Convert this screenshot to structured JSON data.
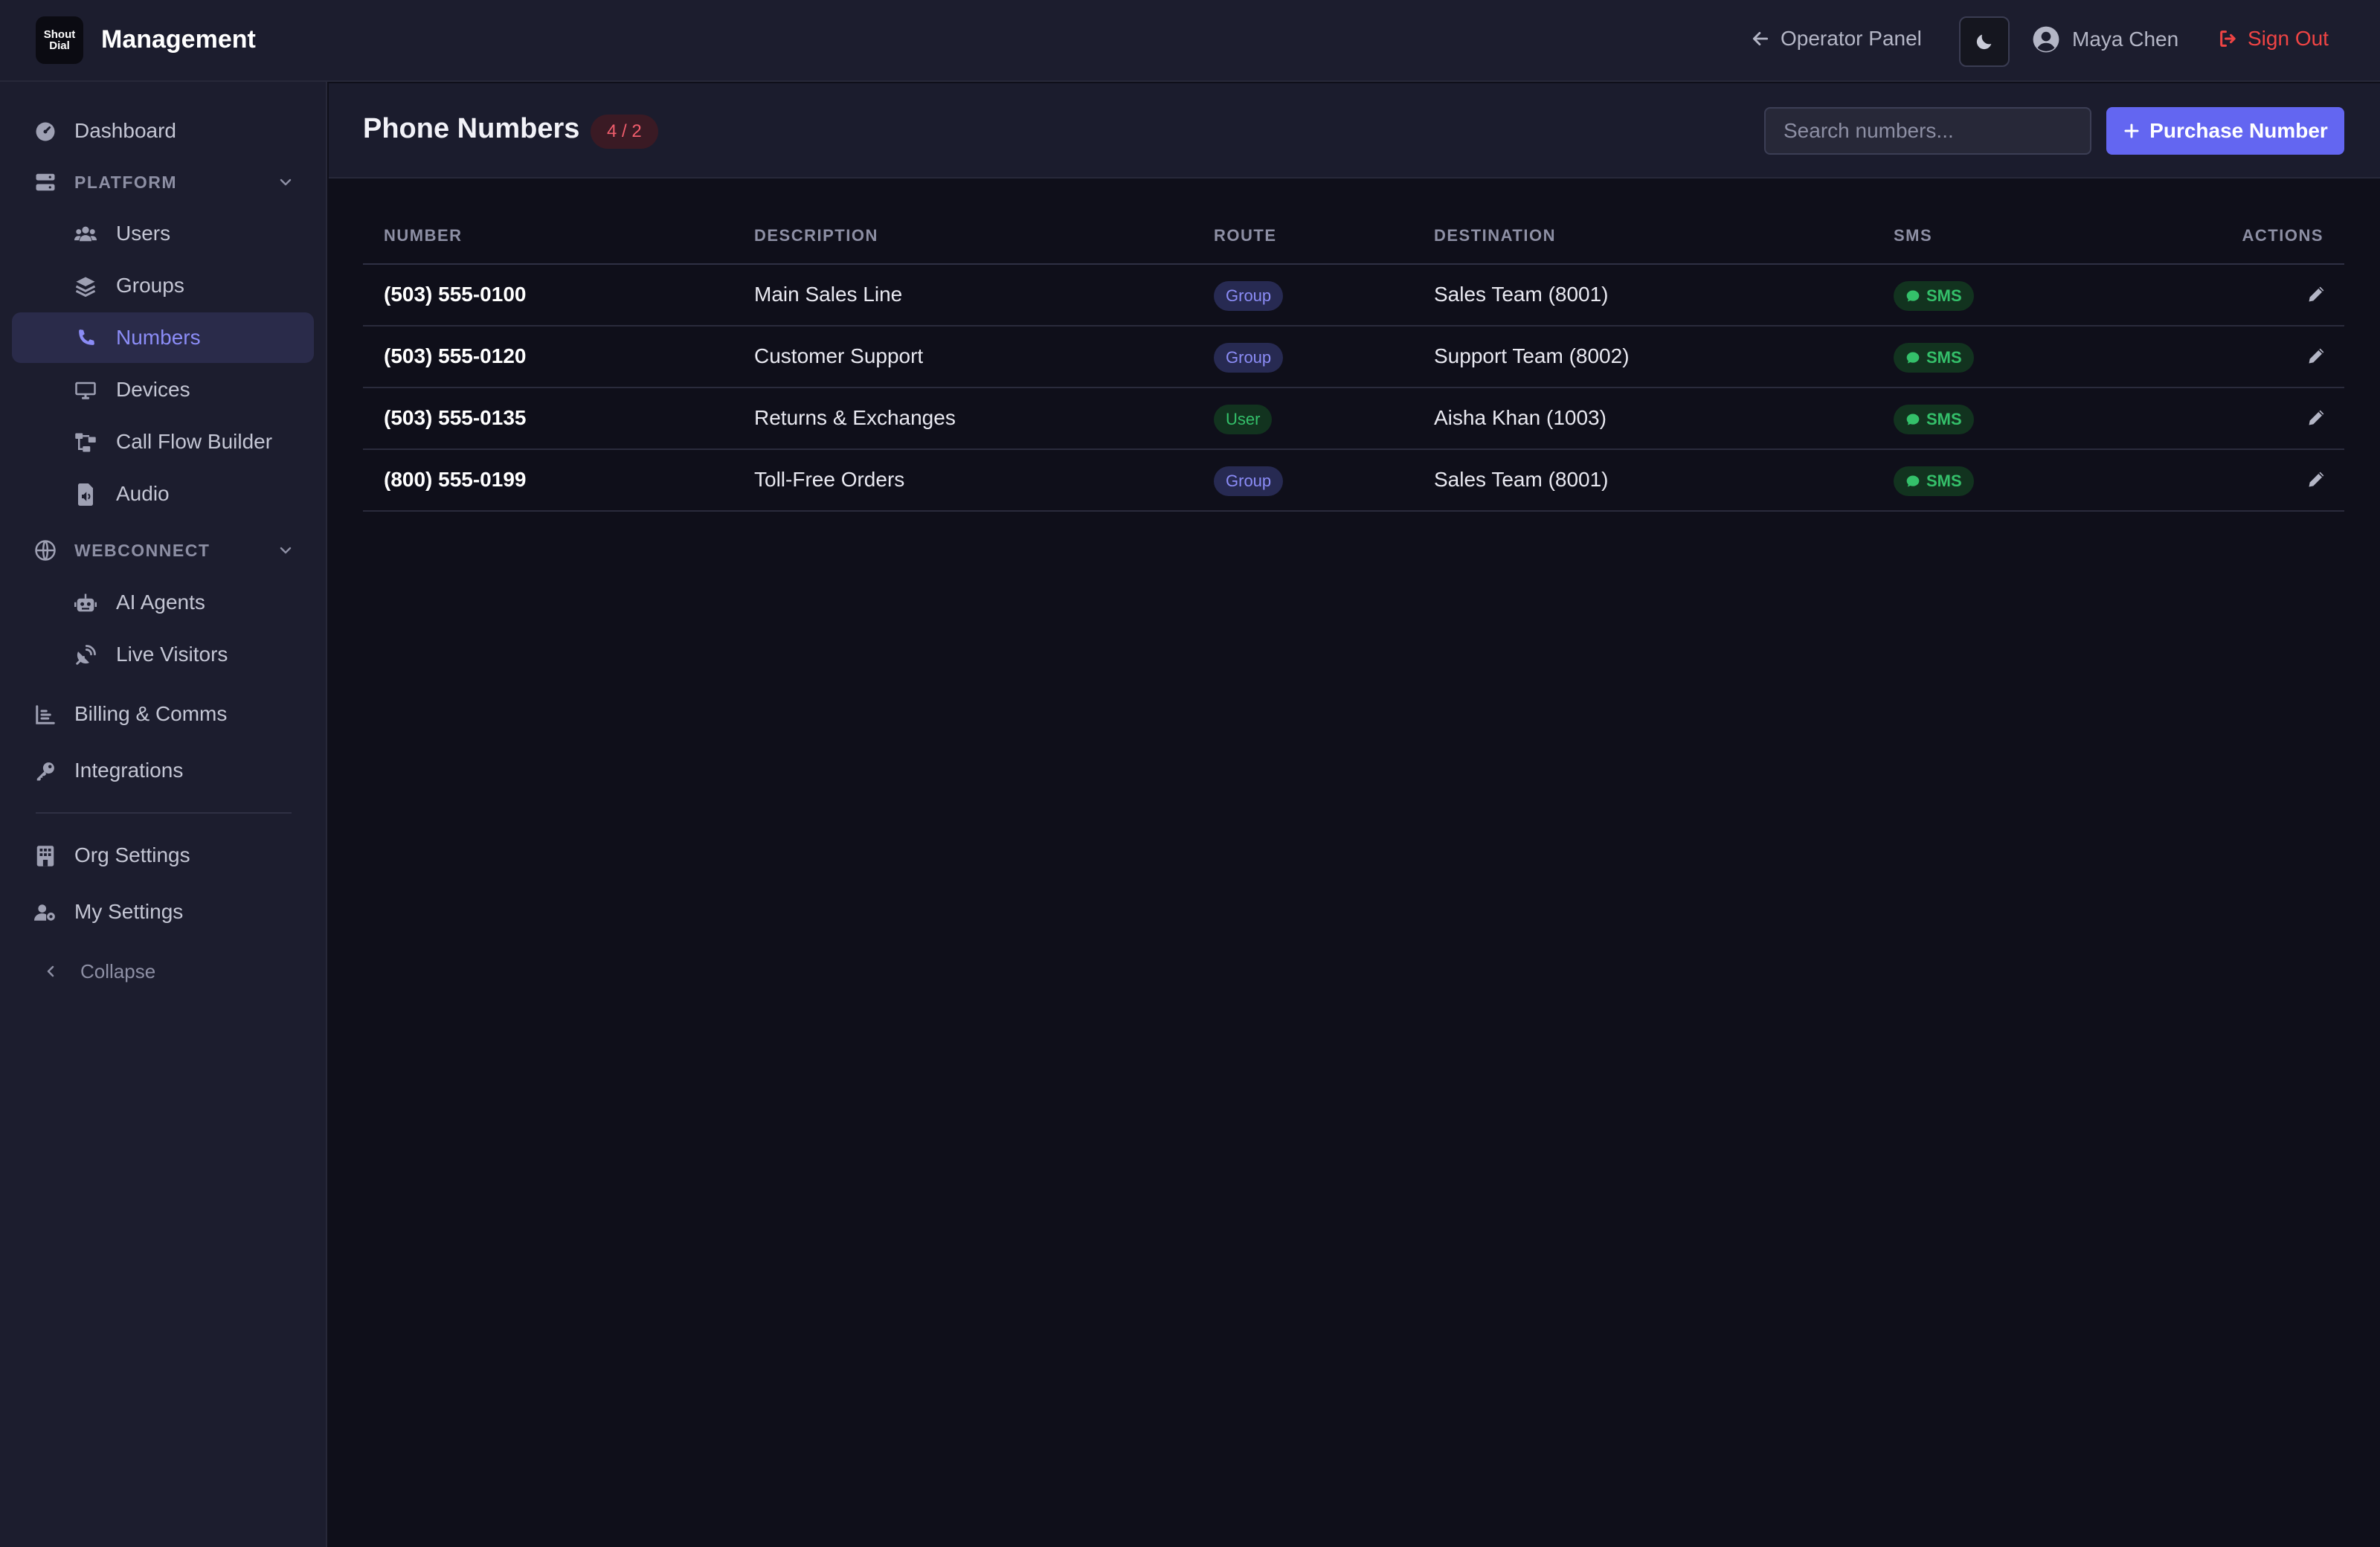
{
  "app": {
    "logo_line1": "Shout",
    "logo_line2": "Dial",
    "title": "Management"
  },
  "topbar": {
    "operator_panel": "Operator Panel",
    "user_name": "Maya Chen",
    "sign_out": "Sign Out",
    "theme_icon": "moon-icon"
  },
  "sidebar": {
    "dashboard": "Dashboard",
    "platform": "PLATFORM",
    "platform_items": [
      "Users",
      "Groups",
      "Numbers",
      "Devices",
      "Call Flow Builder",
      "Audio"
    ],
    "webconnect": "WEBCONNECT",
    "webconnect_items": [
      "AI Agents",
      "Live Visitors"
    ],
    "billing": "Billing & Comms",
    "integrations": "Integrations",
    "org_settings": "Org Settings",
    "my_settings": "My Settings",
    "collapse": "Collapse",
    "active_item": "Numbers"
  },
  "page": {
    "title": "Phone Numbers",
    "count_badge": "4 / 2",
    "search_placeholder": "Search numbers...",
    "purchase_label": "Purchase Number"
  },
  "table": {
    "headers": {
      "number": "NUMBER",
      "description": "DESCRIPTION",
      "route": "ROUTE",
      "destination": "DESTINATION",
      "sms": "SMS",
      "actions": "ACTIONS"
    },
    "rows": [
      {
        "number": "(503) 555-0100",
        "description": "Main Sales Line",
        "route": "Group",
        "destination": "Sales Team (8001)",
        "sms": "SMS"
      },
      {
        "number": "(503) 555-0120",
        "description": "Customer Support",
        "route": "Group",
        "destination": "Support Team (8002)",
        "sms": "SMS"
      },
      {
        "number": "(503) 555-0135",
        "description": "Returns & Exchanges",
        "route": "User",
        "destination": "Aisha Khan (1003)",
        "sms": "SMS"
      },
      {
        "number": "(800) 555-0199",
        "description": "Toll-Free Orders",
        "route": "Group",
        "destination": "Sales Team (8001)",
        "sms": "SMS"
      }
    ]
  },
  "colors": {
    "accent": "#6366f1",
    "danger": "#ef4444",
    "success": "#34c06a",
    "background": "#0f0f1a",
    "panel": "#1c1d2e"
  }
}
